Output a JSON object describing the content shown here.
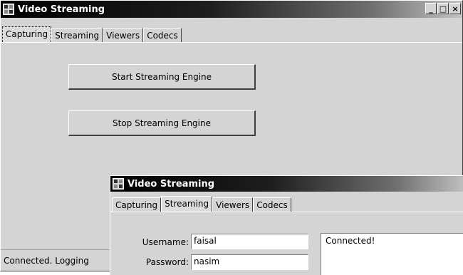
{
  "main_window": {
    "title": "Video Streaming",
    "controls": {
      "minimize": "_",
      "maximize": "□",
      "close": "×"
    },
    "tabs": [
      "Capturing",
      "Streaming",
      "Viewers",
      "Codecs"
    ],
    "active_tab": "Capturing",
    "start_button": "Start Streaming Engine",
    "stop_button": "Stop Streaming Engine",
    "status": "Connected. Logging"
  },
  "second_window": {
    "title": "Video Streaming",
    "tabs": [
      "Capturing",
      "Streaming",
      "Viewers",
      "Codecs"
    ],
    "active_tab": "Streaming",
    "username_label": "Username:",
    "username_value": "faisal",
    "password_label": "Password:",
    "password_value": "nasim",
    "log_text": "Connected!"
  },
  "colors": {
    "title_gradient_start": "#000000",
    "title_gradient_end": "#c2c2c2",
    "window_face": "#d4d4d4"
  }
}
